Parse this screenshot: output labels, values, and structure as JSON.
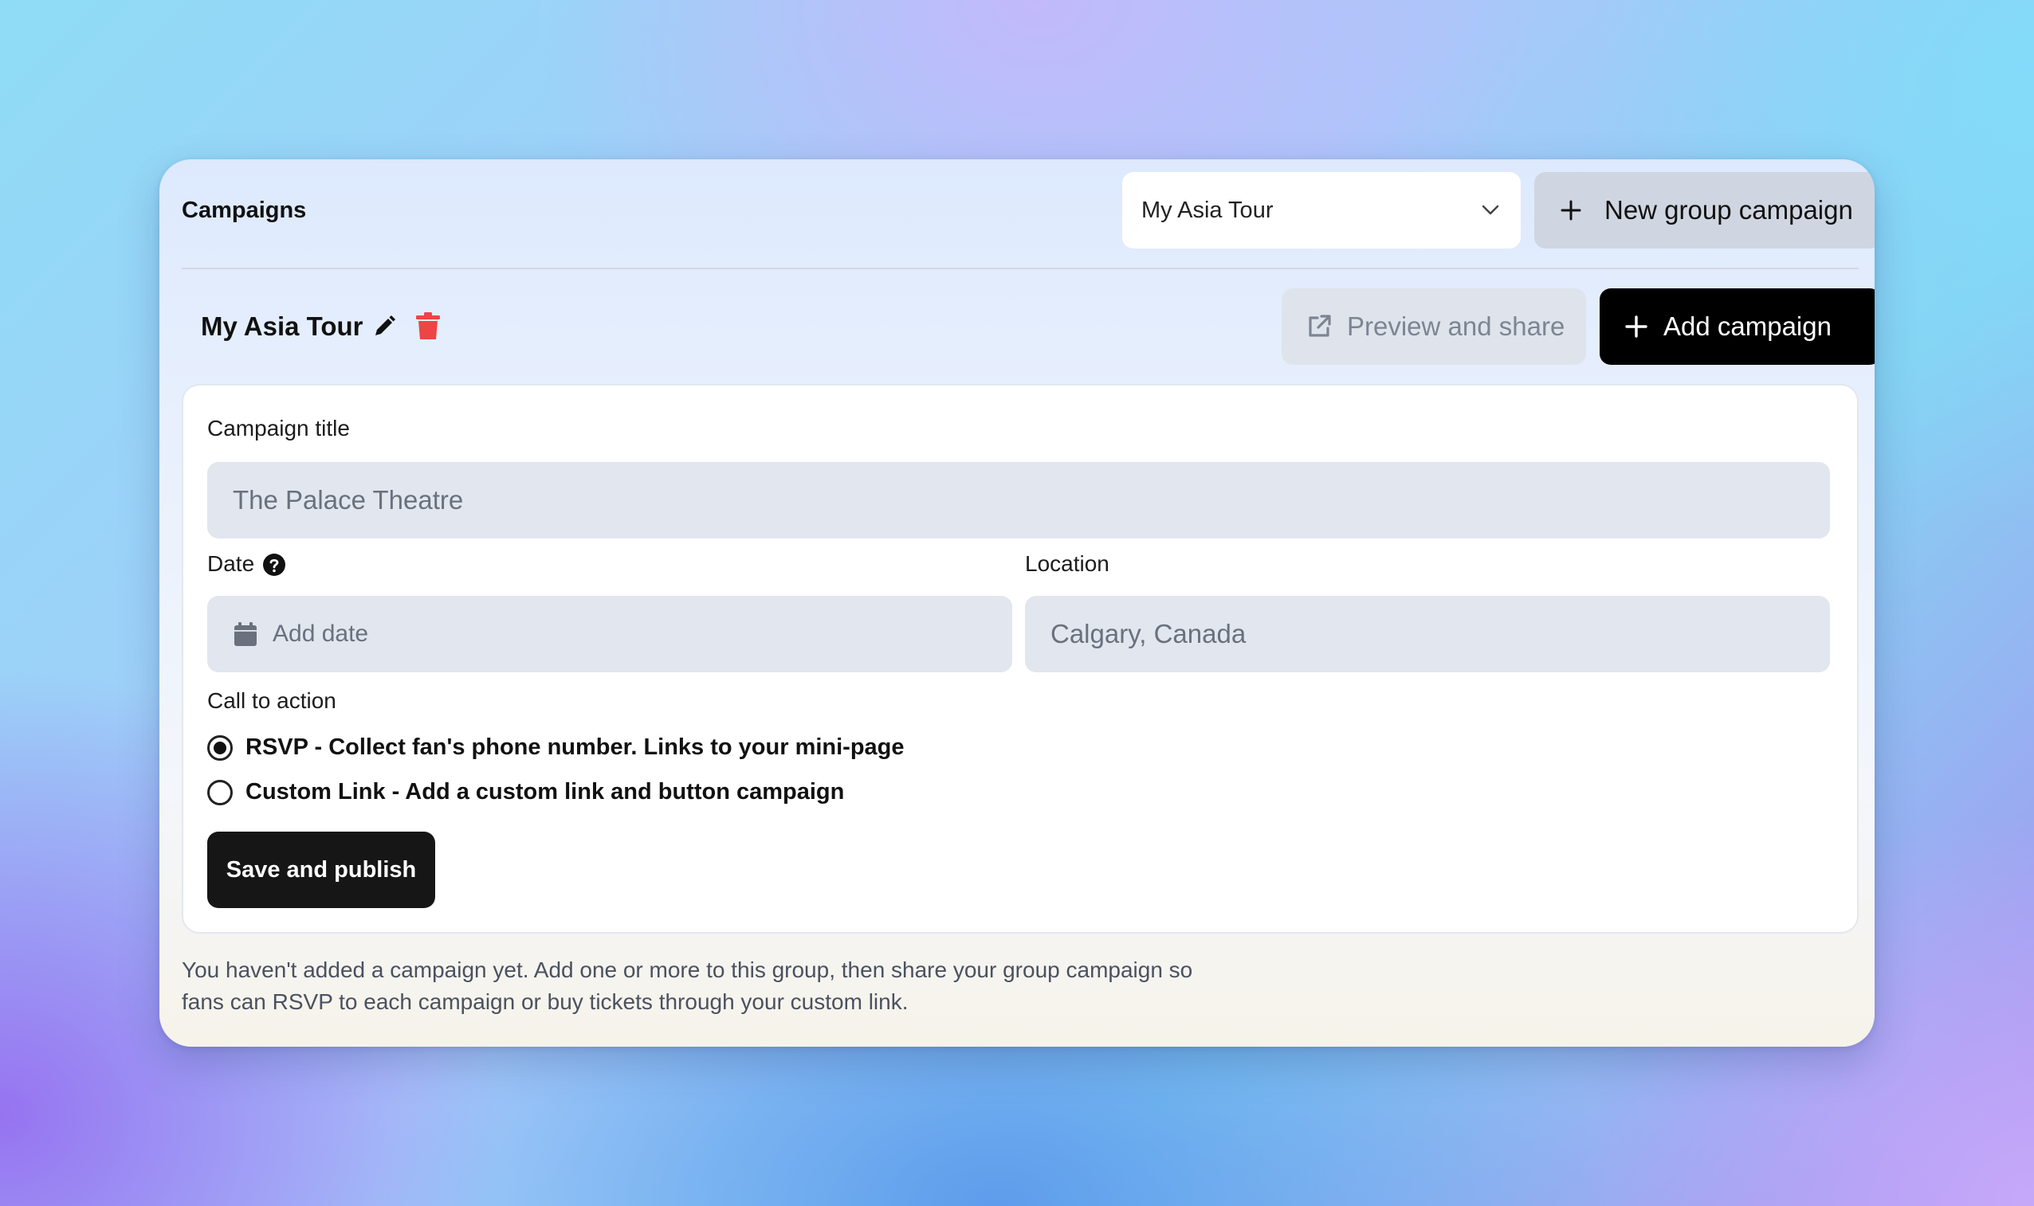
{
  "topbar": {
    "title": "Campaigns",
    "group_select_value": "My Asia Tour",
    "new_group_label": "New group campaign"
  },
  "group": {
    "name": "My Asia Tour",
    "preview_label": "Preview and share",
    "add_campaign_label": "Add campaign"
  },
  "form": {
    "title_label": "Campaign title",
    "title_placeholder": "The Palace Theatre",
    "date_label": "Date",
    "date_placeholder": "Add date",
    "location_label": "Location",
    "location_placeholder": "Calgary, Canada",
    "cta_label": "Call to action",
    "cta_options": [
      {
        "label": "RSVP - Collect fan's phone number. Links to your mini-page",
        "selected": true
      },
      {
        "label": "Custom Link - Add a custom link and button campaign",
        "selected": false
      }
    ],
    "save_label": "Save and publish"
  },
  "empty_note": "You haven't added a campaign yet. Add one or more to this group, then share your group campaign so fans can RSVP to each campaign or buy tickets through your custom link.",
  "colors": {
    "delete_icon": "#ef4444",
    "primary_button": "#000000",
    "input_bg": "#e1e6ef"
  }
}
